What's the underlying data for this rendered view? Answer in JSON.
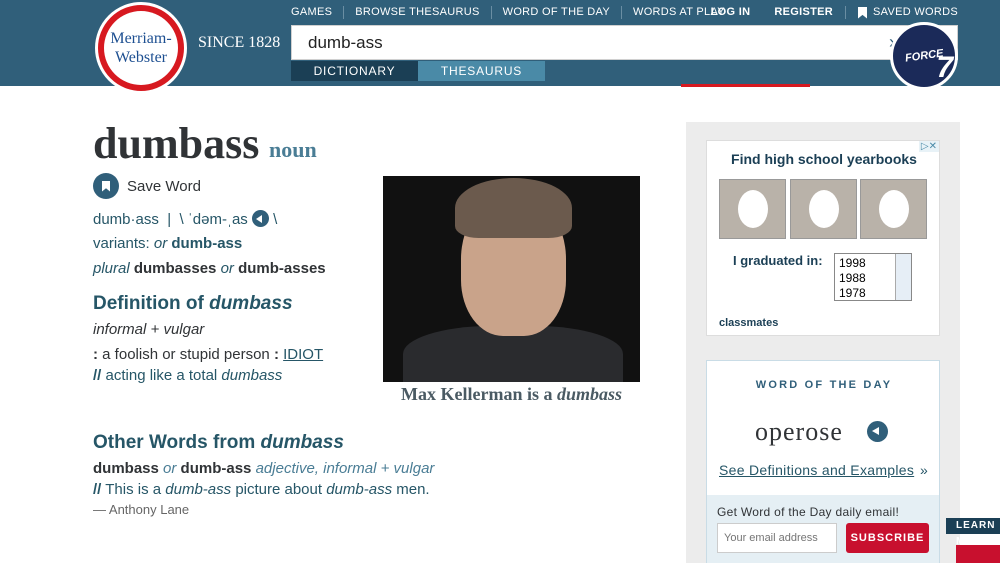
{
  "header": {
    "logo_line1": "Merriam-",
    "logo_line2": "Webster",
    "since": "SINCE 1828",
    "nav": [
      "GAMES",
      "BROWSE THESAURUS",
      "WORD OF THE DAY",
      "WORDS AT PLAY"
    ],
    "login": "LOG IN",
    "register": "REGISTER",
    "saved_words": "SAVED WORDS",
    "search_value": "dumb-ass",
    "tab_dictionary": "DICTIONARY",
    "tab_thesaurus": "THESAURUS",
    "badge_text": "FORCE",
    "badge_number": "7"
  },
  "entry": {
    "headword": "dumbass",
    "function_label": "noun",
    "save_word": "Save Word",
    "syllables": "dumb·ass",
    "pron_sep": "|",
    "pron": "\\ ˈdəm-ˌas",
    "pron_end": "\\",
    "variants_label": "variants:",
    "variants_or": "or",
    "variant": "dumb-ass",
    "plural_label": "plural",
    "plural1": "dumbasses",
    "plural_or": "or",
    "plural2": "dumb-asses",
    "def_heading_pre": "Definition of",
    "def_heading_word": "dumbass",
    "labels": "informal + vulgar",
    "sense_colon": ":",
    "sense_text": "a foolish or stupid person",
    "sense_colon2": ":",
    "sense_xref": "IDIOT",
    "example_slashes": "//",
    "example_pre": "acting like a total",
    "example_word": "dumbass",
    "image_caption_pre": "Max Kellerman is a",
    "image_caption_word": "dumbass",
    "other_heading_pre": "Other Words from",
    "other_heading_word": "dumbass",
    "ow1": "dumbass",
    "ow_or": "or",
    "ow2": "dumb-ass",
    "ow_pos": "adjective, informal + vulgar",
    "ex2_slashes": "//",
    "ex2_a": "This is a",
    "ex2_b": "dumb-ass",
    "ex2_c": "picture about",
    "ex2_d": "dumb-ass",
    "ex2_e": "men.",
    "attribution": "— Anthony Lane"
  },
  "ad": {
    "title": "Find high school yearbooks",
    "graduated": "I graduated in:",
    "years": [
      "1998",
      "1988",
      "1978"
    ],
    "brand": "classmates",
    "adchoice": "▷✕"
  },
  "wod": {
    "heading": "WORD OF THE DAY",
    "word": "operose",
    "link": "See Definitions and Examples",
    "raquo": "»",
    "email_prompt": "Get Word of the Day daily email!",
    "email_placeholder": "Your email address",
    "subscribe": "SUBSCRIBE"
  },
  "learn": "LEARN M"
}
